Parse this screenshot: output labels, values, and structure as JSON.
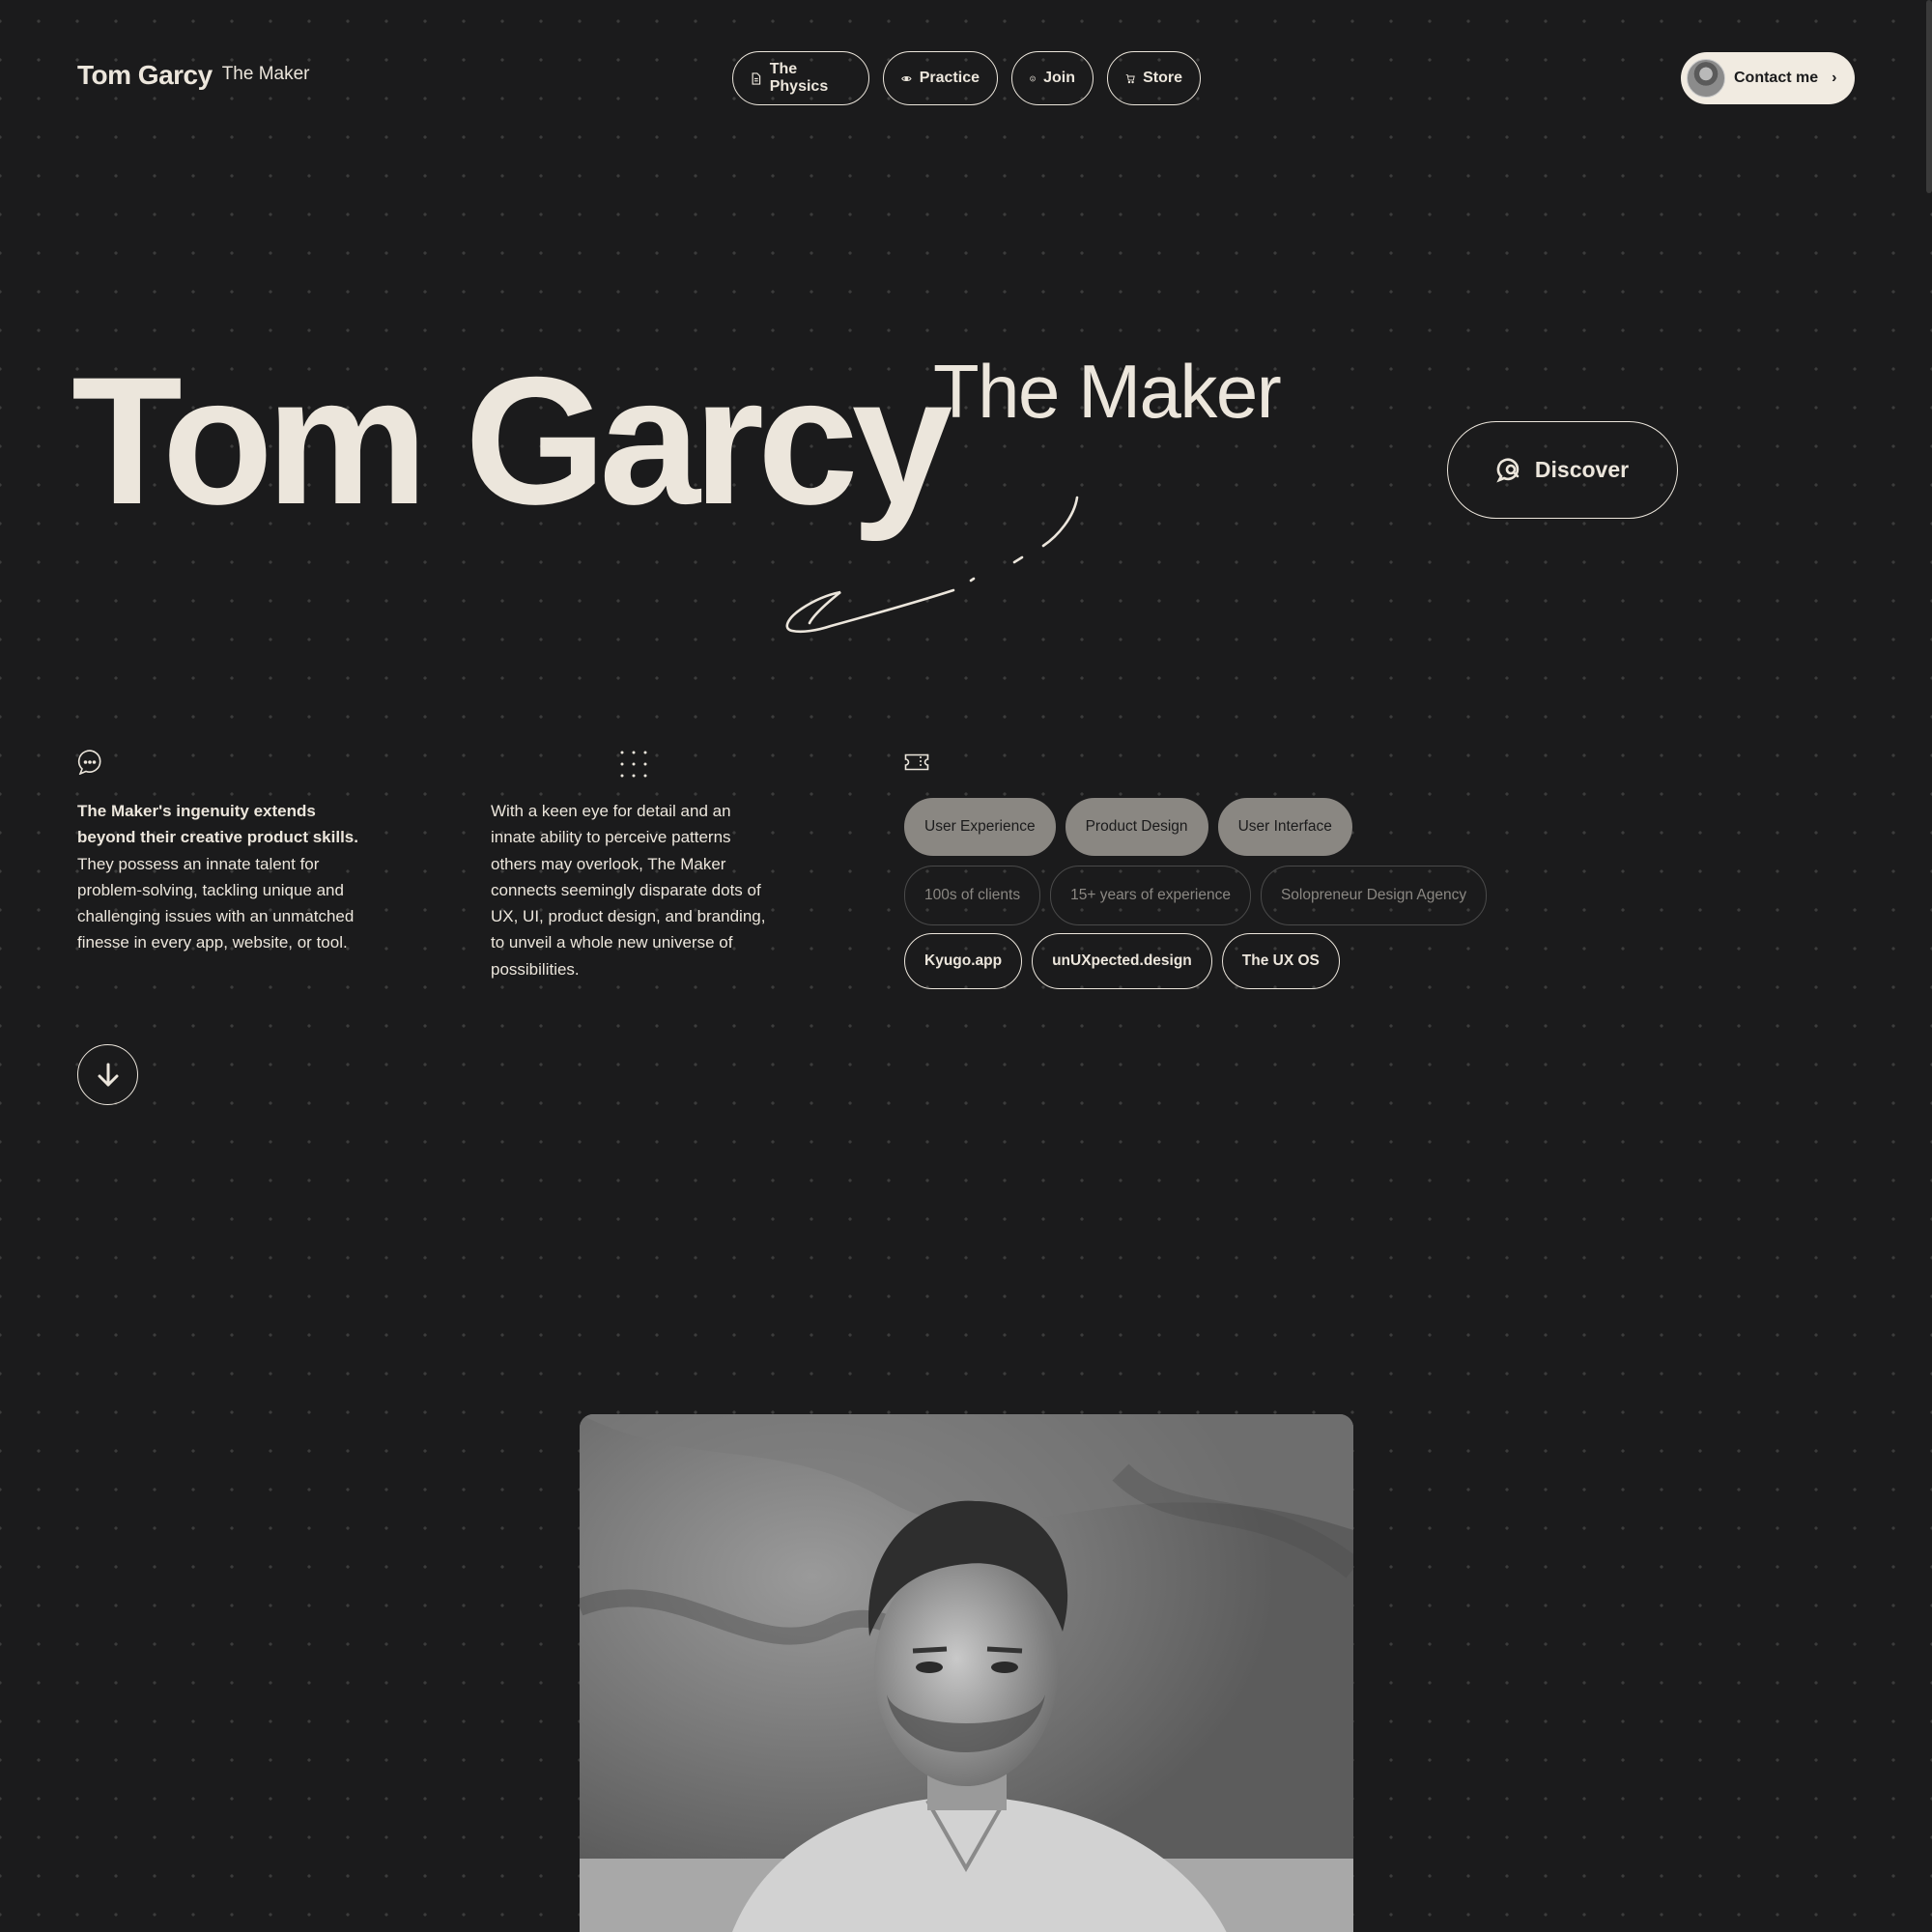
{
  "header": {
    "brand_name": "Tom Garcy",
    "brand_sub": "The Maker",
    "nav": [
      {
        "label": "The Physics",
        "icon": "document-icon"
      },
      {
        "label": "Practice",
        "icon": "eye-icon"
      },
      {
        "label": "Join",
        "icon": "smiley-icon"
      },
      {
        "label": "Store",
        "icon": "cart-icon"
      }
    ],
    "contact_label": "Contact me",
    "contact_icon": "chevron-right-icon"
  },
  "hero": {
    "name": "Tom Garcy",
    "subtitle": "The Maker",
    "discover_label": "Discover",
    "discover_icon": "search-chat-icon"
  },
  "columns": {
    "col1_icon": "chat-bubble-icon",
    "col1_strong": "The Maker's ingenuity extends beyond their creative product skills.",
    "col1_text": " They possess an innate talent for problem-solving, tackling unique and challenging issues with an unmatched finesse in every app, website, or tool.",
    "col2_icon": "dot-grid-icon",
    "col2_text": "With a keen eye for detail and an innate ability to perceive patterns others may overlook, The Maker connects seemingly disparate dots of UX, UI, product design, and branding, to unveil a whole new universe of possibilities.",
    "col3_icon": "ticket-icon"
  },
  "tags": {
    "skills": [
      "User Experience",
      "Product Design",
      "User Interface"
    ],
    "facts": [
      "100s of clients",
      "15+ years of experience",
      "Solopreneur Design Agency"
    ],
    "projects": [
      "Kyugo.app",
      "unUXpected.design",
      "The UX OS"
    ]
  },
  "colors": {
    "background": "#1b1b1c",
    "foreground": "#ece6dc",
    "chip_filled": "#8a8782",
    "contact_bg": "#f1ebe1"
  }
}
